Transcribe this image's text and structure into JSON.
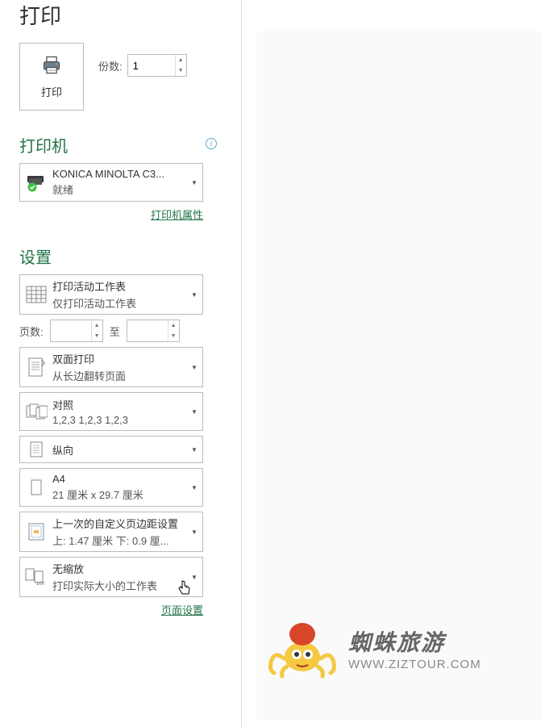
{
  "page_title": "打印",
  "print_button_label": "打印",
  "copies": {
    "label": "份数:",
    "value": "1"
  },
  "printer_section": {
    "title": "打印机"
  },
  "printer": {
    "name": "KONICA MINOLTA C3...",
    "status": "就绪",
    "properties_link": "打印机属性"
  },
  "settings_section": {
    "title": "设置"
  },
  "print_range": {
    "title": "打印活动工作表",
    "sub": "仅打印活动工作表"
  },
  "pages": {
    "label": "页数:",
    "from_value": "",
    "to_label": "至",
    "to_value": ""
  },
  "duplex": {
    "title": "双面打印",
    "sub": "从长边翻转页面"
  },
  "collate": {
    "title": "对照",
    "sub": "1,2,3    1,2,3    1,2,3"
  },
  "orientation": {
    "title": "纵向"
  },
  "paper_size": {
    "title": "A4",
    "sub": "21 厘米 x 29.7 厘米"
  },
  "margins": {
    "title": "上一次的自定义页边距设置",
    "sub": "上: 1.47 厘米 下: 0.9 厘..."
  },
  "scaling": {
    "title": "无缩放",
    "sub": "打印实际大小的工作表"
  },
  "page_setup_link": "页面设置",
  "watermark": {
    "chinese": "蜘蛛旅游",
    "url": "WWW.ZIZTOUR.COM"
  }
}
